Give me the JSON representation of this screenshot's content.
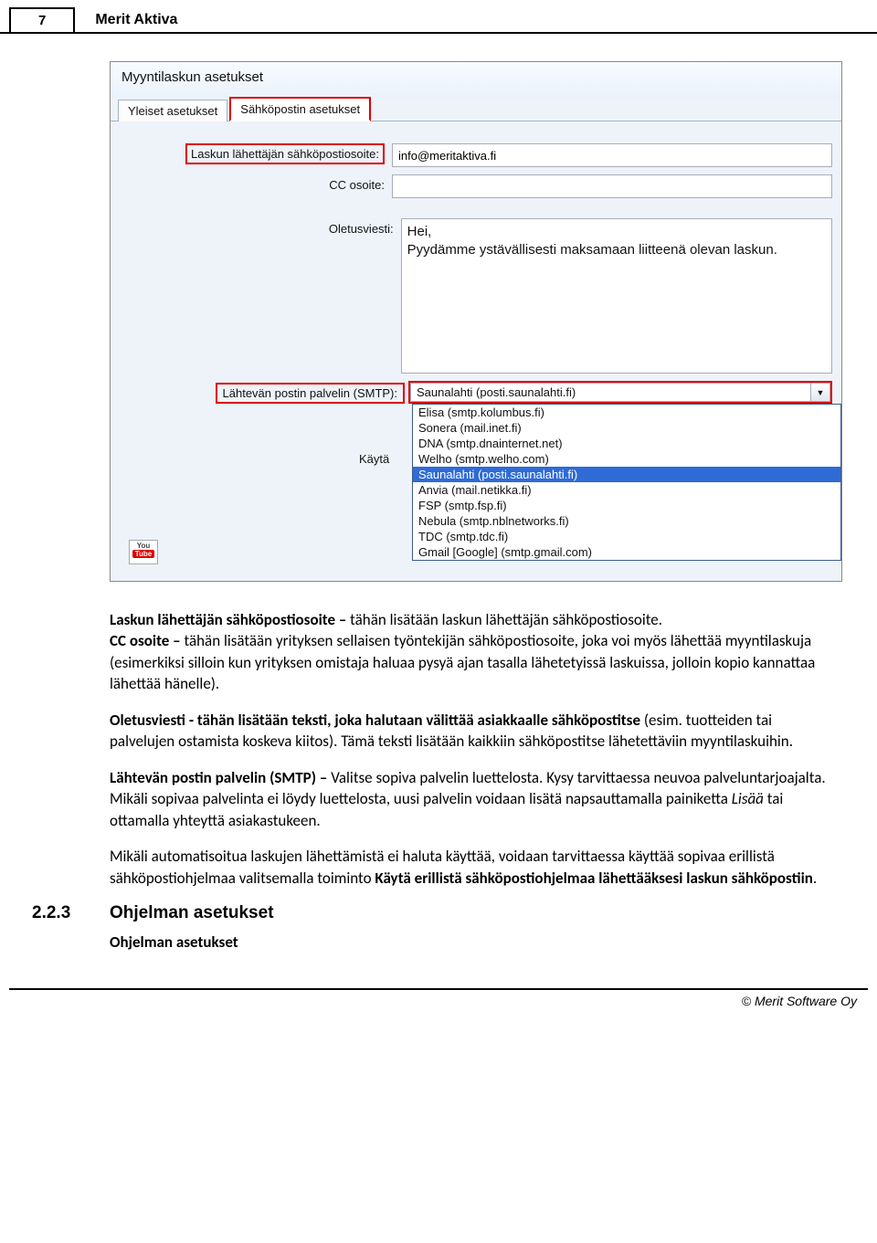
{
  "header": {
    "page_number": "7",
    "title": "Merit Aktiva"
  },
  "screenshot": {
    "window_title": "Myyntilaskun asetukset",
    "tabs": {
      "general": "Yleiset asetukset",
      "email": "Sähköpostin asetukset"
    },
    "fields": {
      "sender_label": "Laskun lähettäjän sähköpostiosoite:",
      "sender_value": "info@meritaktiva.fi",
      "cc_label": "CC osoite:",
      "cc_value": "",
      "default_msg_label": "Oletusviesti:",
      "default_msg_value": "Hei,\nPyydämme ystävällisesti maksamaan liitteenä olevan laskun.",
      "smtp_label": "Lähtevän postin palvelin (SMTP):",
      "smtp_selected": "Saunalahti (posti.saunalahti.fi)",
      "use_label": "Käytä"
    },
    "smtp_options": [
      "Elisa (smtp.kolumbus.fi)",
      "Sonera (mail.inet.fi)",
      "DNA (smtp.dnainternet.net)",
      "Welho (smtp.welho.com)",
      "Saunalahti (posti.saunalahti.fi)",
      "Anvia (mail.netikka.fi)",
      "FSP (smtp.fsp.fi)",
      "Nebula (smtp.nblnetworks.fi)",
      "TDC (smtp.tdc.fi)",
      "Gmail [Google] (smtp.gmail.com)"
    ],
    "smtp_highlight_index": 4,
    "yt_top": "You",
    "yt_bottom": "Tube"
  },
  "body": {
    "p1_b": "Laskun lähettäjän sähköpostiosoite – ",
    "p1_rest": "tähän lisätään laskun lähettäjän sähköpostiosoite.",
    "p2_b": "CC osoite – ",
    "p2_rest": "tähän lisätään yrityksen sellaisen työntekijän sähköpostiosoite, joka voi myös lähettää myyntilaskuja (esimerkiksi silloin kun yrityksen omistaja haluaa pysyä ajan tasalla lähetetyissä laskuissa, jolloin kopio kannattaa lähettää hänelle).",
    "p3_b": "Oletusviesti - tähän lisätään teksti, joka halutaan välittää asiakkaalle sähköpostitse ",
    "p3_rest": "(esim. tuotteiden tai palvelujen ostamista koskeva kiitos). Tämä teksti lisätään kaikkiin sähköpostitse lähetettäviin myyntilaskuihin.",
    "p4_b": "Lähtevän postin palvelin (SMTP) – ",
    "p4_rest_a": "Valitse sopiva palvelin luettelosta. Kysy tarvittaessa neuvoa palveluntarjoajalta. Mikäli sopivaa palvelinta ei löydy luettelosta, uusi palvelin voidaan lisätä napsauttamalla painiketta ",
    "p4_i": "Lisää",
    "p4_rest_b": " tai ottamalla yhteyttä asiakastukeen.",
    "p5_a": "Mikäli automatisoitua laskujen lähettämistä ei haluta käyttää, voidaan tarvittaessa käyttää sopivaa erillistä sähköpostiohjelmaa valitsemalla toiminto ",
    "p5_b": "Käytä erillistä sähköpostiohjelmaa lähettääksesi laskun sähköpostiin",
    "p5_c": "."
  },
  "section": {
    "num": "2.2.3",
    "title": "Ohjelman asetukset"
  },
  "subheading": "Ohjelman asetukset",
  "footer": "© Merit Software Oy"
}
